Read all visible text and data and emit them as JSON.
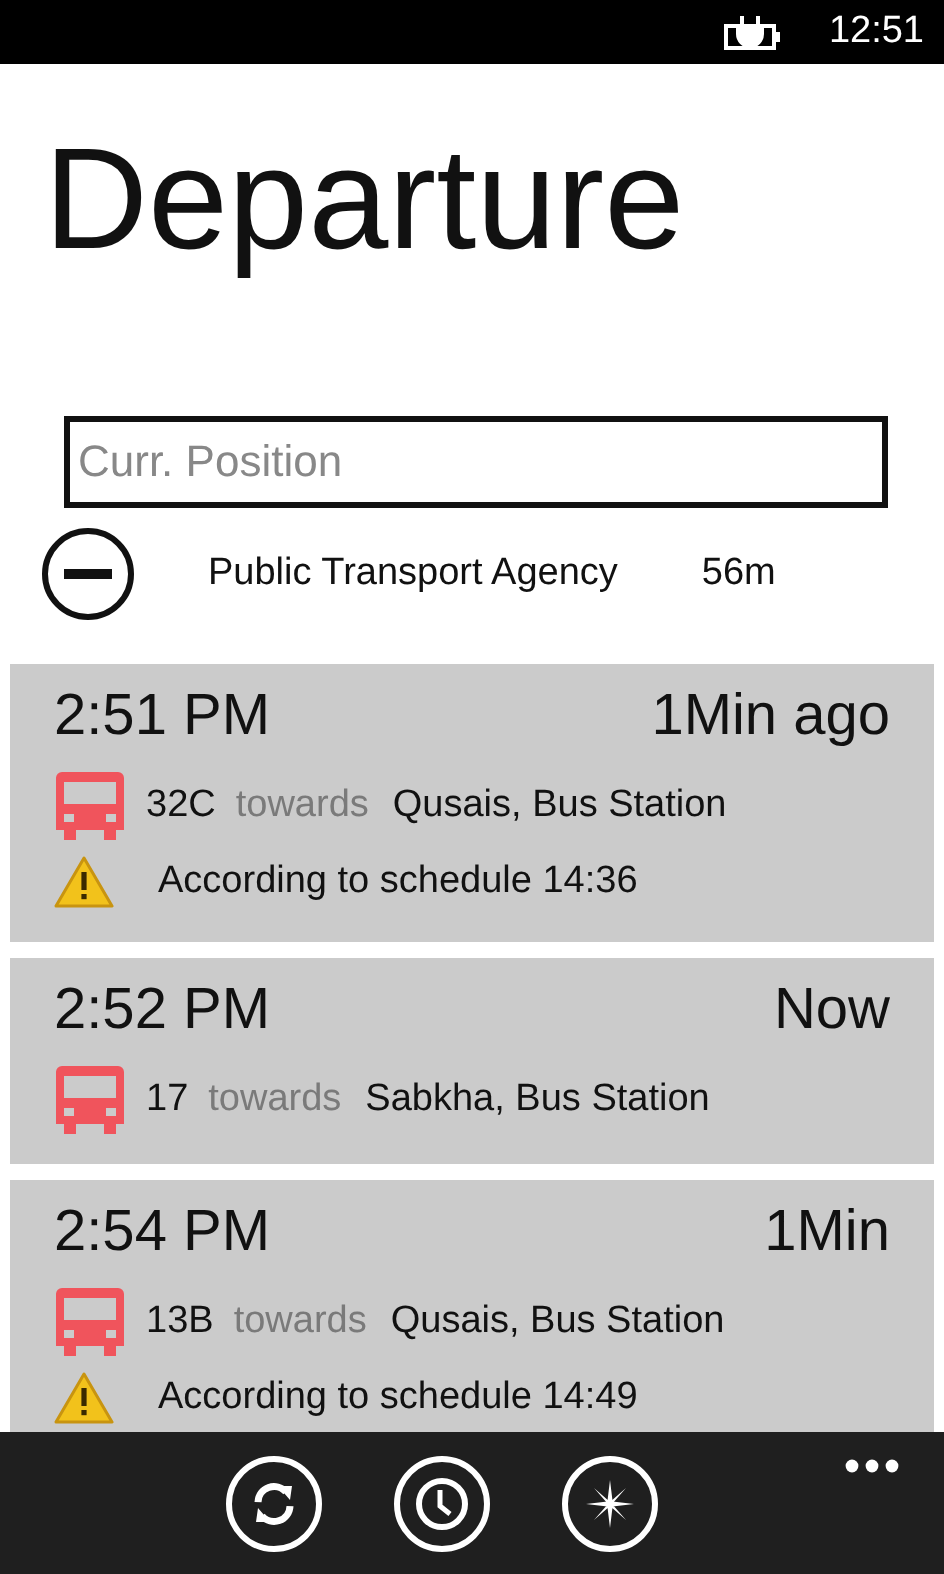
{
  "status_bar": {
    "time": "12:51"
  },
  "title": "Departure",
  "search": {
    "placeholder": "Curr. Position"
  },
  "agency": {
    "name": "Public Transport Agency",
    "distance": "56m"
  },
  "departures": [
    {
      "time": "2:51 PM",
      "relative": "1Min ago",
      "route": "32C",
      "towards": "towards",
      "destination": "Qusais, Bus Station",
      "note": "According to schedule 14:36"
    },
    {
      "time": "2:52 PM",
      "relative": "Now",
      "route": "17",
      "towards": "towards",
      "destination": "Sabkha, Bus Station"
    },
    {
      "time": "2:54 PM",
      "relative": "1Min",
      "route": "13B",
      "towards": "towards",
      "destination": "Qusais, Bus Station",
      "note": "According to schedule 14:49"
    }
  ]
}
